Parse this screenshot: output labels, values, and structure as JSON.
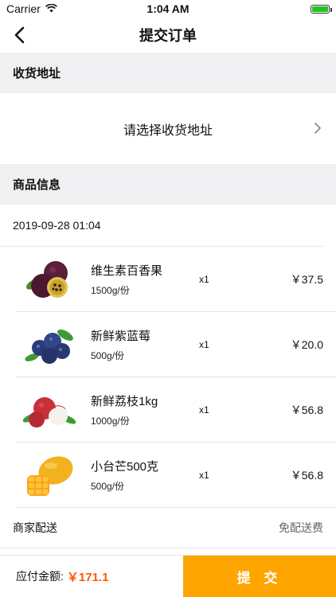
{
  "status_bar": {
    "carrier": "Carrier",
    "time": "1:04 AM"
  },
  "nav": {
    "title": "提交订单"
  },
  "address_section": {
    "title": "收货地址",
    "placeholder": "请选择收货地址"
  },
  "goods_section": {
    "title": "商品信息",
    "date": "2019-09-28 01:04"
  },
  "products": [
    {
      "name": "维生素百香果",
      "spec": "1500g/份",
      "qty": "x1",
      "price": "￥37.5",
      "icon": "passion-fruit-image"
    },
    {
      "name": "新鲜紫蓝莓",
      "spec": "500g/份",
      "qty": "x1",
      "price": "￥20.0",
      "icon": "blueberry-image"
    },
    {
      "name": "新鲜荔枝1kg",
      "spec": "1000g/份",
      "qty": "x1",
      "price": "￥56.8",
      "icon": "lychee-image"
    },
    {
      "name": "小台芒500克",
      "spec": "500g/份",
      "qty": "x1",
      "price": "￥56.8",
      "icon": "mango-image"
    }
  ],
  "delivery": {
    "label": "商家配送",
    "value": "免配送费"
  },
  "footer": {
    "total_label": "应付金额:",
    "total_value": "￥171.1",
    "submit_label": "提 交"
  },
  "colors": {
    "accent": "#ffa500",
    "price": "#ff5a00",
    "section_bg": "#f0f0f2"
  }
}
